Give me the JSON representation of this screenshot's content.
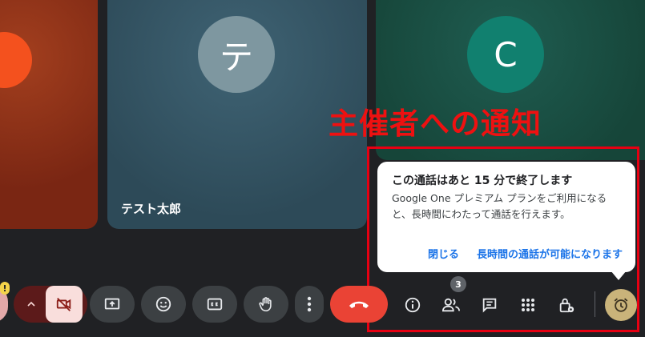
{
  "participants": {
    "middle": {
      "initial": "テ",
      "name": "テスト太郎"
    },
    "right": {
      "initial": "C"
    }
  },
  "annotation": {
    "label": "主催者への通知"
  },
  "notice": {
    "title": "この通話はあと 15 分で終了します",
    "body": "Google One プレミアム プランをご利用になると、長時間にわたって通話を行えます。",
    "close_label": "閉じる",
    "extend_label": "長時間の通話が可能になります"
  },
  "controls": {
    "people_count": "3",
    "warn_symbol": "!"
  },
  "icons": [
    "chevron-up-icon",
    "camera-off-icon",
    "present-screen-icon",
    "emoji-icon",
    "captions-icon",
    "raise-hand-icon",
    "more-vert-icon",
    "end-call-icon",
    "info-icon",
    "people-icon",
    "chat-icon",
    "activities-icon",
    "host-controls-icon",
    "alarm-icon"
  ],
  "colors": {
    "end_call": "#ea4335",
    "accent_link": "#1a73e8",
    "annotation_red": "#e60012"
  }
}
